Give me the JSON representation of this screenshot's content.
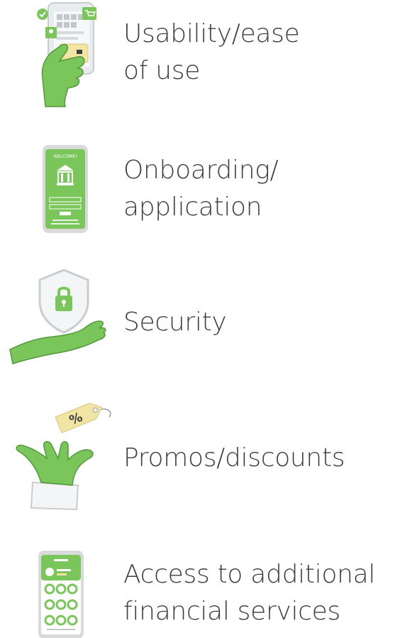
{
  "features": [
    {
      "id": "usability",
      "icon": "hand-holding-phone-icon",
      "lines": [
        "Usability/ease",
        "of use"
      ]
    },
    {
      "id": "onboarding",
      "icon": "bank-app-phone-icon",
      "lines": [
        "Onboarding/",
        "application"
      ]
    },
    {
      "id": "security",
      "icon": "hand-shield-lock-icon",
      "lines": [
        "Security"
      ]
    },
    {
      "id": "promos",
      "icon": "hand-discount-tag-icon",
      "lines": [
        "Promos/discounts"
      ]
    },
    {
      "id": "services",
      "icon": "financial-services-phone-icon",
      "lines": [
        "Access to additional",
        "financial services"
      ]
    }
  ],
  "icon_text": {
    "welcome": "WELCOME!",
    "percent": "%"
  },
  "colors": {
    "green": "#7bc65a",
    "green_dark": "#4f9a3a",
    "yellow": "#f2e4a3",
    "text": "#3e3e3e",
    "gray": "#cfd2d4"
  }
}
